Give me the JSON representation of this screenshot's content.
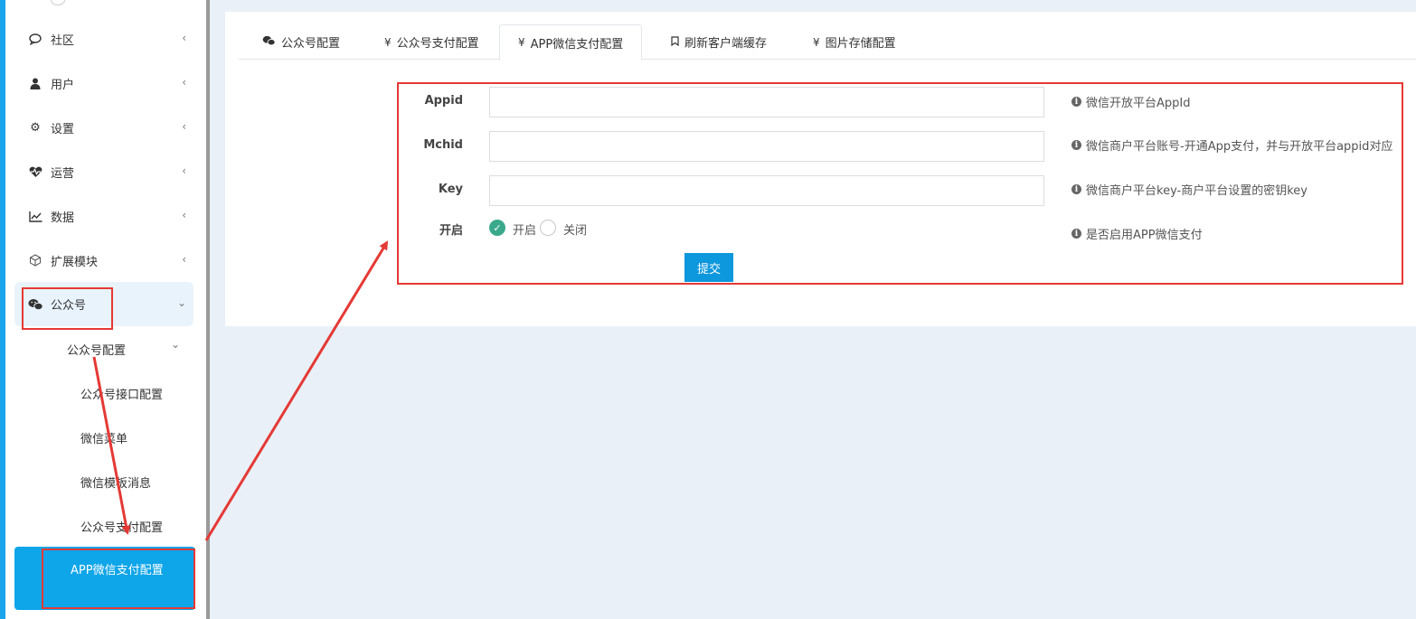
{
  "sidebar": {
    "items": [
      {
        "label": "社区",
        "icon": "chat-bubble-icon"
      },
      {
        "label": "用户",
        "icon": "user-icon"
      },
      {
        "label": "设置",
        "icon": "gear-icon"
      },
      {
        "label": "运营",
        "icon": "heartbeat-icon"
      },
      {
        "label": "数据",
        "icon": "line-chart-icon"
      },
      {
        "label": "扩展模块",
        "icon": "cube-icon"
      },
      {
        "label": "公众号",
        "icon": "wechat-icon"
      }
    ],
    "subgroup": {
      "label": "公众号配置"
    },
    "subitems": [
      {
        "label": "公众号接口配置"
      },
      {
        "label": "微信菜单"
      },
      {
        "label": "微信模板消息"
      },
      {
        "label": "公众号支付配置"
      }
    ],
    "active_leaf": {
      "label": "APP微信支付配置"
    }
  },
  "tabs": [
    {
      "label": "公众号配置",
      "icon": "wechat-icon"
    },
    {
      "label": "公众号支付配置",
      "icon": "yen-icon"
    },
    {
      "label": "APP微信支付配置",
      "icon": "yen-icon",
      "active": true
    },
    {
      "label": "刷新客户端缓存",
      "icon": "bookmark-icon"
    },
    {
      "label": "图片存储配置",
      "icon": "yen-icon"
    }
  ],
  "form": {
    "appid": {
      "label": "Appid",
      "value": "",
      "help": "微信开放平台AppId"
    },
    "mchid": {
      "label": "Mchid",
      "value": "",
      "help": "微信商户平台账号-开通App支付，并与开放平台appid对应"
    },
    "key": {
      "label": "Key",
      "value": "",
      "help": "微信商户平台key-商户平台设置的密钥key"
    },
    "enable": {
      "label": "开启",
      "option_on": "开启",
      "option_off": "关闭",
      "selected": "开启",
      "help": "是否启用APP微信支付"
    },
    "submit_label": "提交"
  },
  "colors": {
    "accent": "#0ea5e9",
    "annotation": "#e53935",
    "radio_on": "#3aa98b"
  }
}
